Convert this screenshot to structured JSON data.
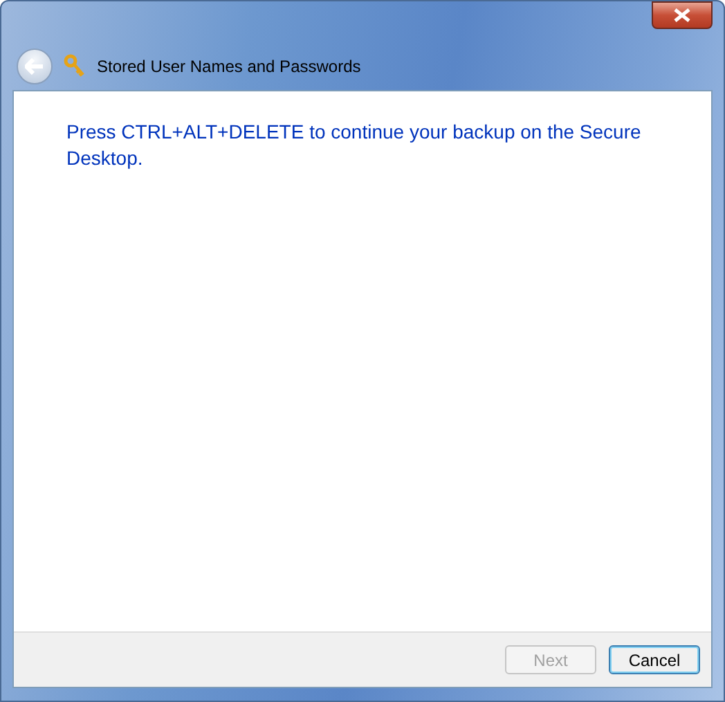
{
  "window": {
    "title": "Stored User Names and Passwords"
  },
  "message": "Press CTRL+ALT+DELETE to continue your backup on the Secure Desktop.",
  "buttons": [
    {
      "label": "Next",
      "disabled": true,
      "default": false
    },
    {
      "label": "Cancel",
      "disabled": false,
      "default": true
    }
  ]
}
